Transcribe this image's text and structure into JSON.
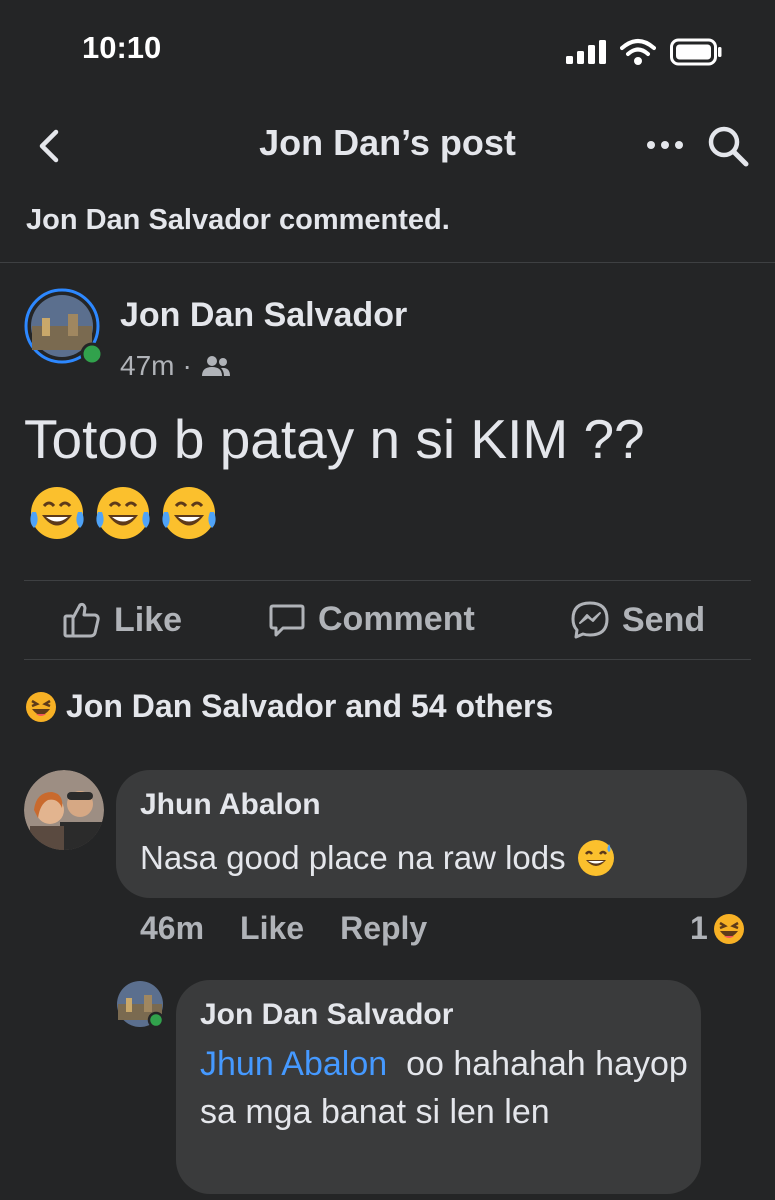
{
  "status": {
    "time": "10:10"
  },
  "nav": {
    "title": "Jon Dan’s post"
  },
  "notice": "Jon Dan Salvador commented.",
  "post": {
    "author": "Jon Dan Salvador",
    "time": "47m",
    "dot": "·",
    "text_line1": "Totoo b patay n si KIM ??",
    "emoji_count": 3
  },
  "actions": {
    "like": "Like",
    "comment": "Comment",
    "send": "Send"
  },
  "reactions": {
    "summary": "Jon Dan Salvador and 54 others"
  },
  "comment1": {
    "author": "Jhun Abalon",
    "text": "Nasa good place na raw lods",
    "time": "46m",
    "like": "Like",
    "reply": "Reply",
    "reaction_count": "1"
  },
  "reply1": {
    "author": "Jon Dan Salvador",
    "mention": "Jhun Abalon",
    "text": "oo hahahah hayop sa mga banat si len len"
  },
  "colors": {
    "background": "#242526",
    "bubble": "#3a3b3c",
    "mention": "#4599ff",
    "secondary": "#b0b3b8"
  }
}
